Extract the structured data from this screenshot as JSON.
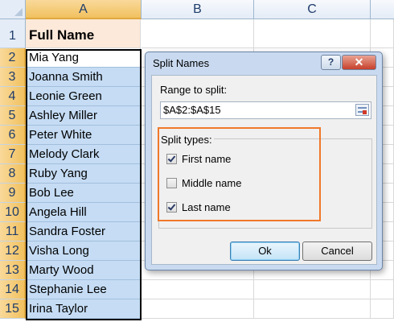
{
  "spreadsheet": {
    "columns": [
      {
        "label": "A",
        "selected": true
      },
      {
        "label": "B",
        "selected": false
      },
      {
        "label": "C",
        "selected": false
      }
    ],
    "rows": [
      {
        "num": "1",
        "value": "Full Name"
      },
      {
        "num": "2",
        "value": "Mia Yang"
      },
      {
        "num": "3",
        "value": "Joanna Smith"
      },
      {
        "num": "4",
        "value": "Leonie Green"
      },
      {
        "num": "5",
        "value": "Ashley Miller"
      },
      {
        "num": "6",
        "value": "Peter White"
      },
      {
        "num": "7",
        "value": "Melody Clark"
      },
      {
        "num": "8",
        "value": "Ruby Yang"
      },
      {
        "num": "9",
        "value": "Bob Lee"
      },
      {
        "num": "10",
        "value": "Angela Hill"
      },
      {
        "num": "11",
        "value": "Sandra Foster"
      },
      {
        "num": "12",
        "value": "Visha Long"
      },
      {
        "num": "13",
        "value": "Marty Wood"
      },
      {
        "num": "14",
        "value": "Stephanie Lee"
      },
      {
        "num": "15",
        "value": "Irina Taylor"
      }
    ]
  },
  "dialog": {
    "title": "Split Names",
    "help_label": "?",
    "close_label": "✕",
    "range_label": "Range to split:",
    "range_value": "$A$2:$A$15",
    "split_types_label": "Split types:",
    "options": [
      {
        "label": "First name",
        "checked": true
      },
      {
        "label": "Middle name",
        "checked": false
      },
      {
        "label": "Last name",
        "checked": true
      }
    ],
    "ok_label": "Ok",
    "cancel_label": "Cancel"
  },
  "colors": {
    "selection_fill": "#c5dcf4",
    "header_cell_fill": "#fde9d9",
    "highlight_outline": "#f0782a",
    "selected_header": "#f1c15f"
  }
}
